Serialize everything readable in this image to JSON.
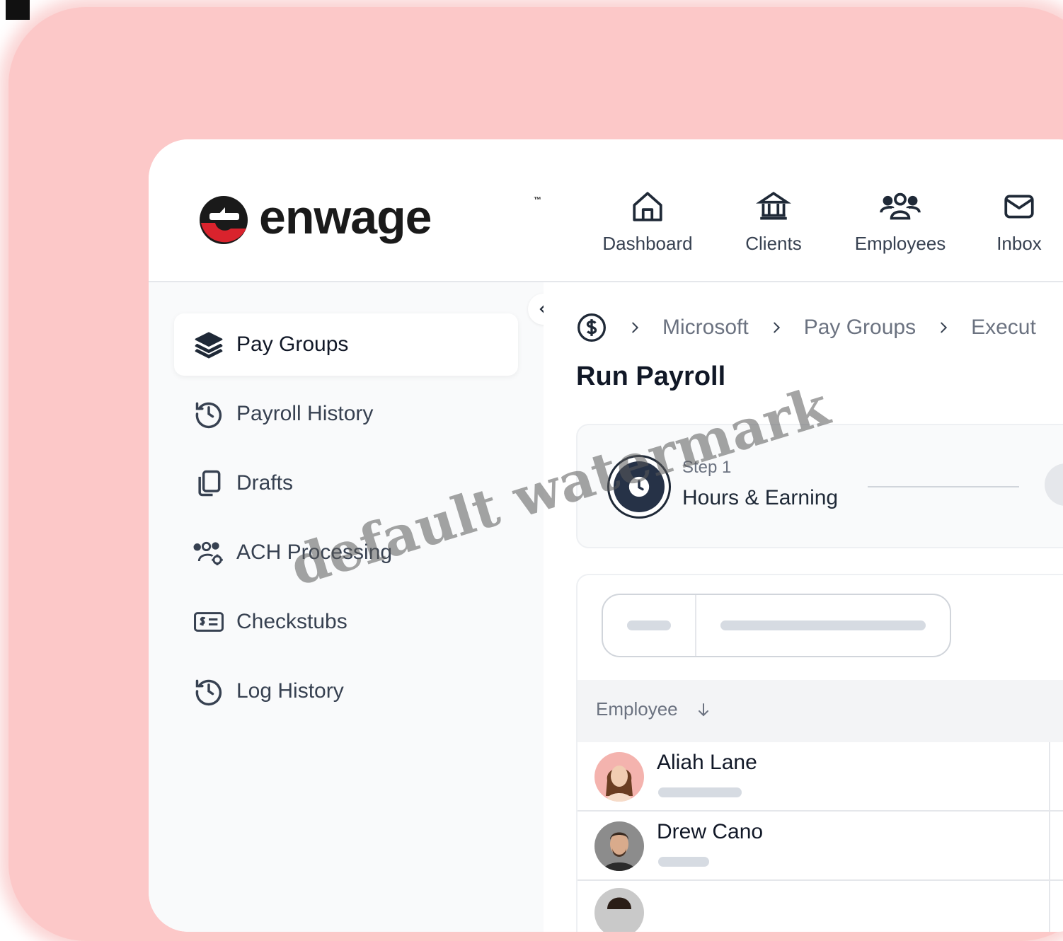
{
  "brand": {
    "name": "enwage",
    "trademark": "™",
    "accent": "#d9232d"
  },
  "topnav": [
    {
      "label": "Dashboard",
      "icon": "home-icon"
    },
    {
      "label": "Clients",
      "icon": "bank-icon"
    },
    {
      "label": "Employees",
      "icon": "users-icon"
    },
    {
      "label": "Inbox",
      "icon": "mail-icon"
    }
  ],
  "sidebar": {
    "items": [
      {
        "label": "Pay Groups",
        "icon": "layers-icon",
        "active": true
      },
      {
        "label": "Payroll History",
        "icon": "history-icon"
      },
      {
        "label": "Drafts",
        "icon": "copy-icon"
      },
      {
        "label": "ACH Processing",
        "icon": "users-gear-icon"
      },
      {
        "label": "Checkstubs",
        "icon": "check-stub-icon"
      },
      {
        "label": "Log History",
        "icon": "history-icon"
      }
    ]
  },
  "breadcrumb": [
    "Microsoft",
    "Pay Groups",
    "Execut"
  ],
  "page": {
    "title": "Run Payroll"
  },
  "stepper": {
    "step_label": "Step 1",
    "step_name": "Hours & Earning"
  },
  "table": {
    "column": "Employee",
    "rows": [
      {
        "name": "Aliah Lane"
      },
      {
        "name": "Drew Cano"
      }
    ]
  },
  "watermark": "default watermark"
}
